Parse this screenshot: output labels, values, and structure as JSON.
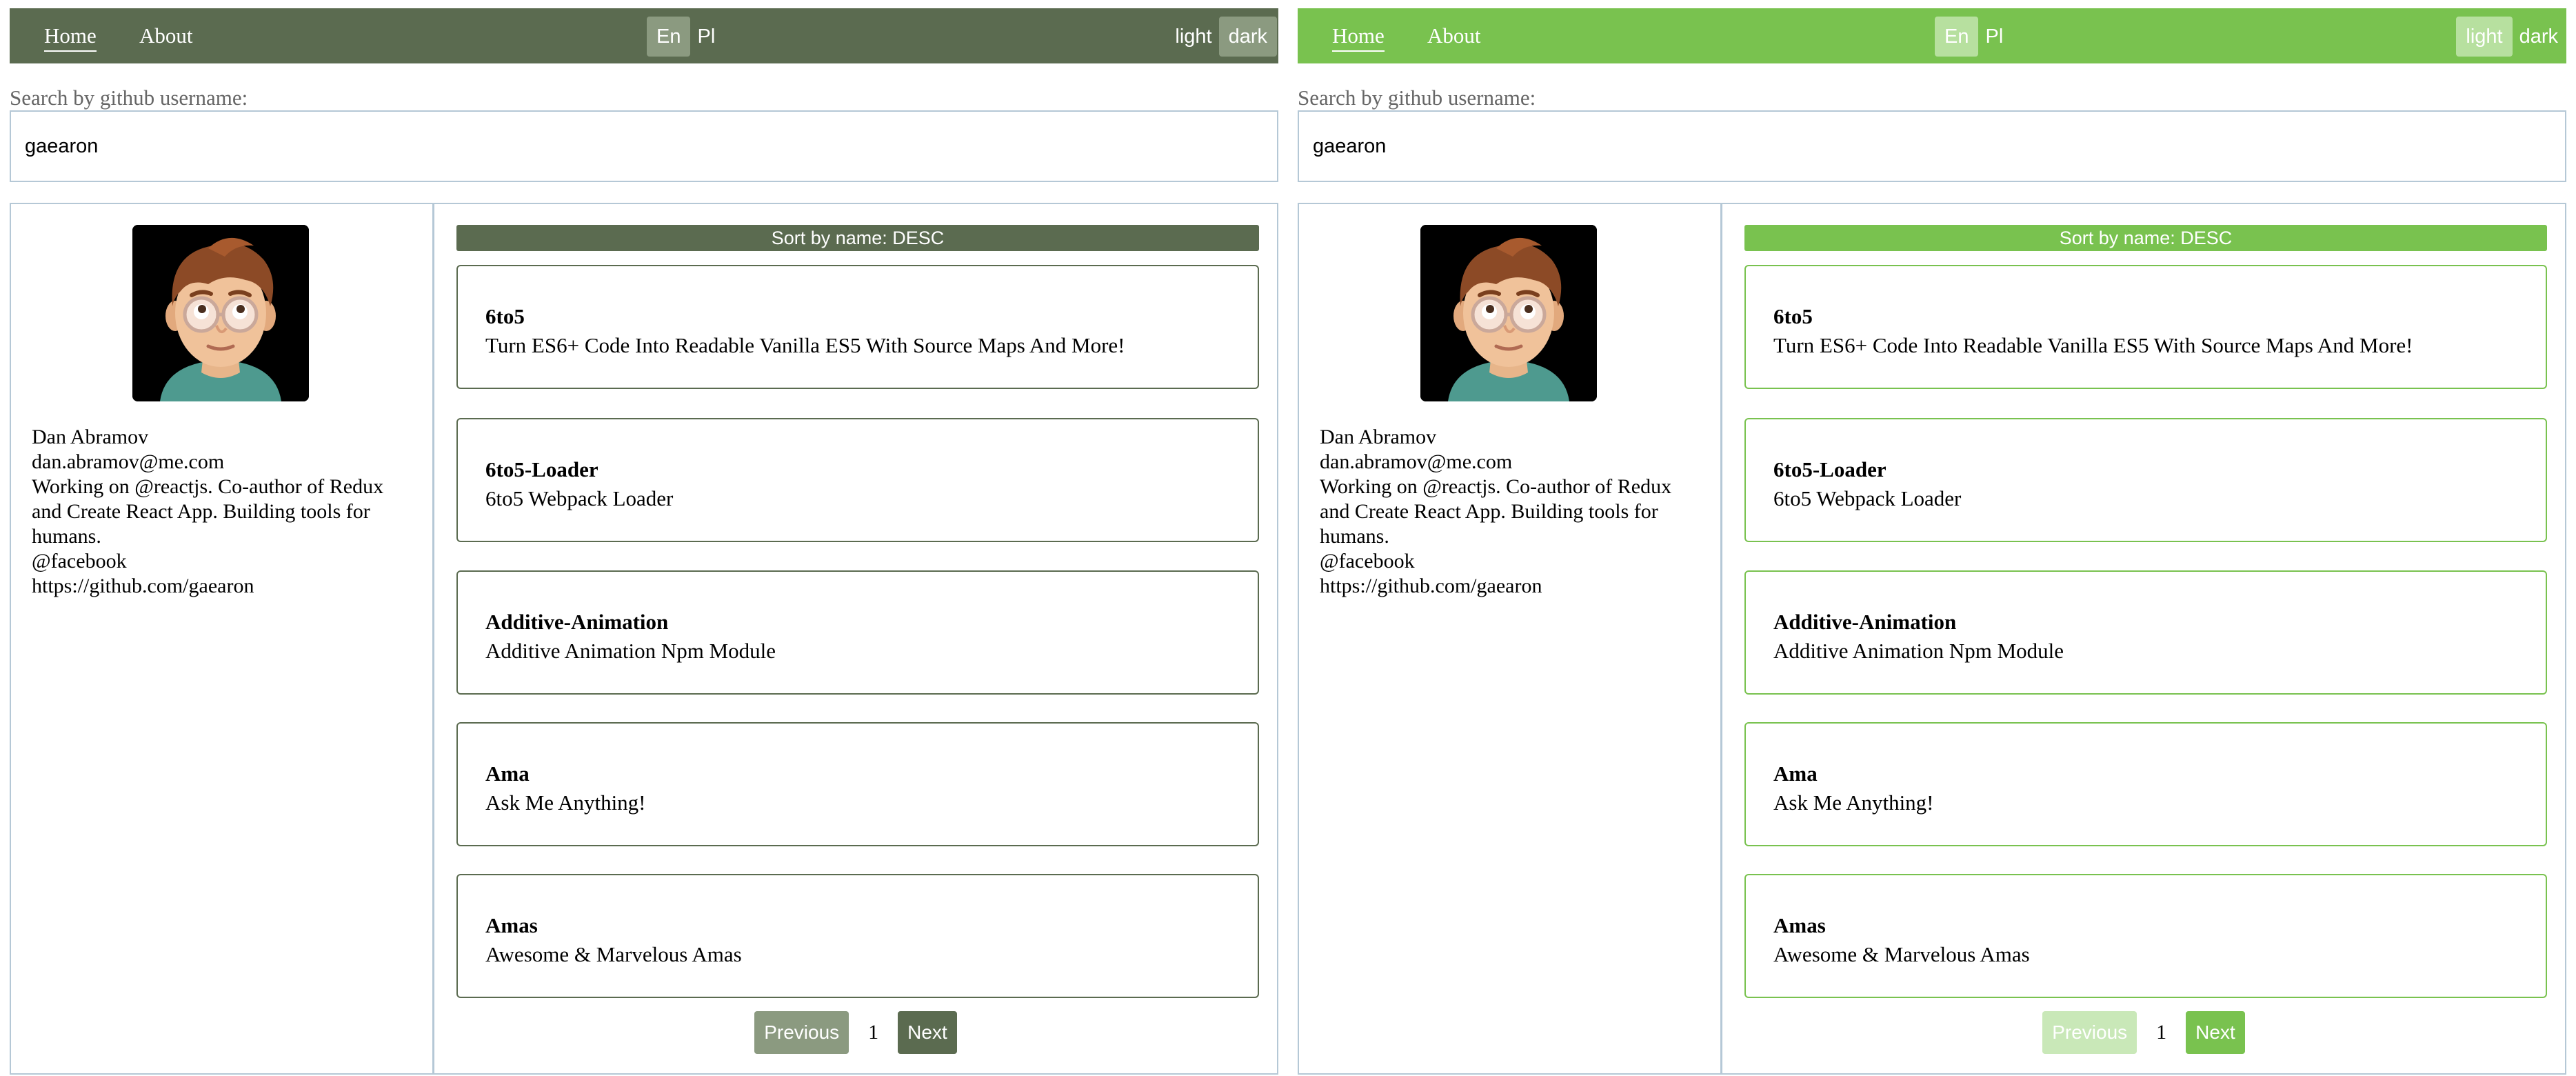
{
  "nav": {
    "home": "Home",
    "about": "About"
  },
  "lang": {
    "en": "En",
    "pl": "Pl"
  },
  "mode": {
    "light": "light",
    "dark": "dark"
  },
  "search": {
    "label": "Search by github username:",
    "value": "gaearon"
  },
  "profile": {
    "name": "Dan Abramov",
    "email": "dan.abramov@me.com",
    "bio": "Working on @reactjs. Co-author of Redux and Create React App. Building tools for humans.",
    "company": "@facebook",
    "url": "https://github.com/gaearon"
  },
  "sort_label": "Sort by name: DESC",
  "repos": [
    {
      "name": "6to5",
      "description": "Turn ES6+ Code Into Readable Vanilla ES5 With Source Maps And More!"
    },
    {
      "name": "6to5-Loader",
      "description": "6to5 Webpack Loader"
    },
    {
      "name": "Additive-Animation",
      "description": "Additive Animation Npm Module"
    },
    {
      "name": "Ama",
      "description": "Ask Me Anything!"
    },
    {
      "name": "Amas",
      "description": "Awesome & Marvelous Amas"
    }
  ],
  "pagination": {
    "previous": "Previous",
    "page": "1",
    "next": "Next"
  },
  "colors": {
    "dark_theme": "#5b6b50",
    "light_theme": "#79c24f",
    "border": "#b5c8d6"
  },
  "icons": {
    "avatar": "memoji-avatar"
  }
}
